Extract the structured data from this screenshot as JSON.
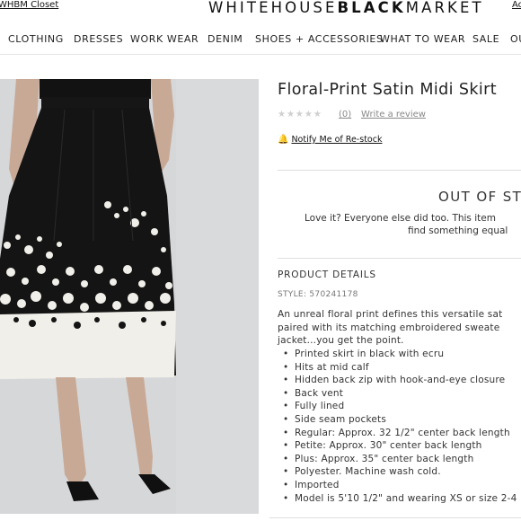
{
  "header": {
    "closet_link": "WHBM Closet",
    "logo_light_1": "WHITE",
    "logo_light_2": "HOUSE",
    "logo_bold": "BLACK",
    "logo_light_3": "MARKET",
    "account_link": "Ac"
  },
  "nav": {
    "items": [
      "CLOTHING",
      "DRESSES",
      "WORK WEAR",
      "DENIM",
      "SHOES + ACCESSORIES",
      "WHAT TO WEAR",
      "SALE",
      "OU"
    ]
  },
  "product": {
    "title": "Floral-Print Satin Midi Skirt",
    "stars": "★★★★★",
    "review_count": "(0)",
    "write_review": "Write a review",
    "notify": "Notify Me of Re-stock",
    "out_of_stock": "OUT OF ST",
    "oos_message_1": "Love it? Everyone else did too. This item",
    "oos_message_2": "find something equal",
    "details_heading": "PRODUCT DETAILS",
    "style_line": "STYLE: 570241178",
    "description": [
      "An unreal floral print defines this versatile sat",
      "paired with its matching embroidered sweate",
      "jacket...you get the point."
    ],
    "details": [
      "Printed skirt in black with ecru",
      "Hits at mid calf",
      "Hidden back zip with hook-and-eye closure",
      "Back vent",
      "Fully lined",
      "Side seam pockets",
      "Regular: Approx. 32 1/2\" center back length",
      "Petite: Approx. 30\" center back length",
      "Plus: Approx. 35\" center back length",
      "Polyester. Machine wash cold.",
      "Imported",
      "Model is 5'10 1/2\" and wearing XS or size 2-4"
    ]
  },
  "colors": {
    "skirt_black": "#141414",
    "skirt_ecru": "#f1efe9",
    "photo_background": "#d8d9db",
    "divider": "#dedede"
  }
}
